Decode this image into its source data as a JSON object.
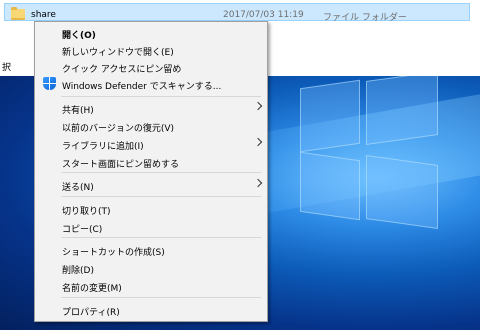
{
  "file_row": {
    "name": "share",
    "date": "2017/07/03 11:19",
    "type": "ファイル フォルダー"
  },
  "edge_text": "択",
  "menu": {
    "open": "開く(O)",
    "open_new_window": "新しいウィンドウで開く(E)",
    "pin_quick_access": "クイック アクセスにピン留め",
    "defender_scan": "Windows Defender でスキャンする...",
    "share": "共有(H)",
    "restore_previous": "以前のバージョンの復元(V)",
    "add_to_library": "ライブラリに追加(I)",
    "pin_start": "スタート画面にピン留めする",
    "send_to": "送る(N)",
    "cut": "切り取り(T)",
    "copy": "コピー(C)",
    "create_shortcut": "ショートカットの作成(S)",
    "delete": "削除(D)",
    "rename": "名前の変更(M)",
    "properties": "プロパティ(R)"
  },
  "icons": {
    "folder": "folder-icon",
    "defender": "shield-icon",
    "submenu": "chevron-right-icon"
  },
  "colors": {
    "selection_bg": "#cce8ff",
    "menu_bg": "#f2f2f2",
    "desktop_blue": "#0c5bb8"
  }
}
